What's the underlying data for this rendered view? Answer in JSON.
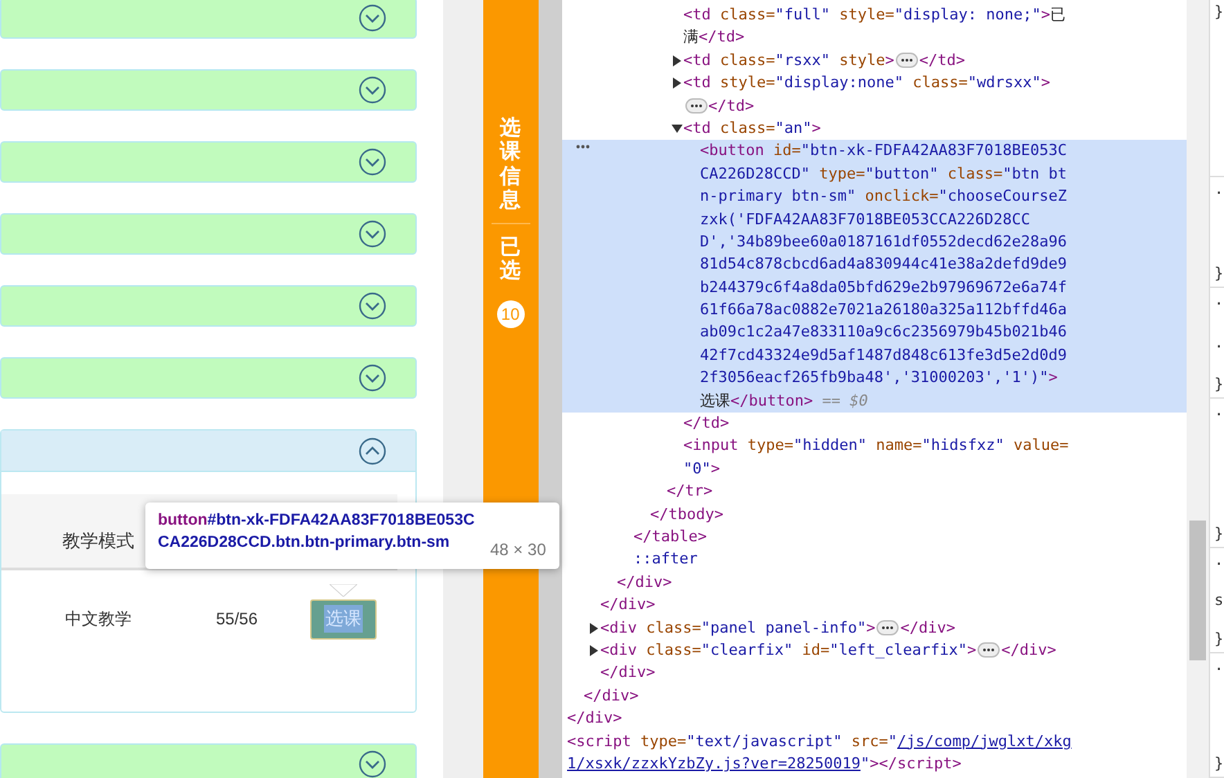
{
  "panels": [
    {
      "expanded": false
    },
    {
      "expanded": false
    },
    {
      "expanded": false
    },
    {
      "expanded": false
    },
    {
      "expanded": false
    },
    {
      "expanded": false
    },
    {
      "expanded": true,
      "table": {
        "columns": [
          "教学模式"
        ],
        "rows": [
          {
            "cells": [
              "中文教学",
              "55/56"
            ],
            "button": "选课"
          }
        ]
      }
    },
    {
      "expanded": false
    }
  ],
  "inspect_tooltip": {
    "tag": "button",
    "selector": "#btn-xk-FDFA42AA83F7018BE053CCA226D28CCD.btn.btn-primary.btn-sm",
    "size": "48 × 30"
  },
  "side_tab": {
    "label": "选课信息",
    "selected_label": "已选",
    "count": "10"
  },
  "elements": [
    {
      "children": [
        {
          "children": [
            {
              "children": [
                {
                  "children": [
                    {
                      "children": [
                        {
                          "children": [
                            {
                              "children": [
                                {
                                  "selected": false,
                                  "lines": [
                                    [
                                      {
                                        "kind": "tag",
                                        "text": "<td"
                                      },
                                      {
                                        "kind": "attr",
                                        "text": " class="
                                      },
                                      {
                                        "kind": "val",
                                        "text": "\"full\""
                                      },
                                      {
                                        "kind": "attr",
                                        "text": " style="
                                      },
                                      {
                                        "kind": "val",
                                        "text": "\"display: none;\""
                                      },
                                      {
                                        "kind": "tag",
                                        "text": ">"
                                      },
                                      {
                                        "kind": "text",
                                        "text": "已"
                                      }
                                    ],
                                    [
                                      {
                                        "kind": "text",
                                        "text": "满"
                                      },
                                      {
                                        "kind": "tag",
                                        "text": "</td>"
                                      }
                                    ]
                                  ]
                                },
                                {
                                  "selected": false,
                                  "expanded": false,
                                  "lines": [
                                    [
                                      {
                                        "kind": "tag",
                                        "text": "<td"
                                      },
                                      {
                                        "kind": "attr",
                                        "text": " class="
                                      },
                                      {
                                        "kind": "val",
                                        "text": "\"rsxx\""
                                      },
                                      {
                                        "kind": "attr",
                                        "text": " style"
                                      },
                                      {
                                        "kind": "tag",
                                        "text": ">"
                                      },
                                      {
                                        "kind": "badge"
                                      },
                                      {
                                        "kind": "tag",
                                        "text": "</td>"
                                      }
                                    ]
                                  ]
                                },
                                {
                                  "selected": false,
                                  "expanded": false,
                                  "lines": [
                                    [
                                      {
                                        "kind": "tag",
                                        "text": "<td"
                                      },
                                      {
                                        "kind": "attr",
                                        "text": " style="
                                      },
                                      {
                                        "kind": "val",
                                        "text": "\"display:none\""
                                      },
                                      {
                                        "kind": "attr",
                                        "text": " class="
                                      },
                                      {
                                        "kind": "val",
                                        "text": "\"wdrsxx\""
                                      },
                                      {
                                        "kind": "tag",
                                        "text": ">"
                                      }
                                    ],
                                    [
                                      {
                                        "kind": "badge"
                                      },
                                      {
                                        "kind": "tag",
                                        "text": "</td>"
                                      }
                                    ]
                                  ]
                                },
                                {
                                  "selected": false,
                                  "expanded": true,
                                  "lines": [
                                    [
                                      {
                                        "kind": "tag",
                                        "text": "<td"
                                      },
                                      {
                                        "kind": "attr",
                                        "text": " class="
                                      },
                                      {
                                        "kind": "val",
                                        "text": "\"an\""
                                      },
                                      {
                                        "kind": "tag",
                                        "text": ">"
                                      }
                                    ]
                                  ],
                                  "children": [
                                    {
                                      "selected": true,
                                      "lines": [
                                        [
                                          {
                                            "kind": "tag",
                                            "text": "<button"
                                          },
                                          {
                                            "kind": "attr",
                                            "text": " id="
                                          },
                                          {
                                            "kind": "val",
                                            "text": "\"btn-xk-FDFA42AA83F7018BE053C"
                                          }
                                        ],
                                        [
                                          {
                                            "kind": "val",
                                            "text": "CA226D28CCD\""
                                          },
                                          {
                                            "kind": "attr",
                                            "text": " type="
                                          },
                                          {
                                            "kind": "val",
                                            "text": "\"button\""
                                          },
                                          {
                                            "kind": "attr",
                                            "text": " class="
                                          },
                                          {
                                            "kind": "val",
                                            "text": "\"btn bt"
                                          }
                                        ],
                                        [
                                          {
                                            "kind": "val",
                                            "text": "n-primary btn-sm\""
                                          },
                                          {
                                            "kind": "attr",
                                            "text": " onclick="
                                          },
                                          {
                                            "kind": "val",
                                            "text": "\"chooseCourseZ"
                                          }
                                        ],
                                        [
                                          {
                                            "kind": "val",
                                            "text": "zxk('FDFA42AA83F7018BE053CCA226D28CC"
                                          }
                                        ],
                                        [
                                          {
                                            "kind": "val",
                                            "text": "D','34b89bee60a0187161df0552decd62e28a96"
                                          }
                                        ],
                                        [
                                          {
                                            "kind": "val",
                                            "text": "81d54c878cbcd6ad4a830944c41e38a2defd9de9"
                                          }
                                        ],
                                        [
                                          {
                                            "kind": "val",
                                            "text": "b244379c6f4a8da05bfd629e2b97969672e6a74f"
                                          }
                                        ],
                                        [
                                          {
                                            "kind": "val",
                                            "text": "61f66a78ac0882e7021a26180a325a112bffd46a"
                                          }
                                        ],
                                        [
                                          {
                                            "kind": "val",
                                            "text": "ab09c1c2a47e833110a9c6c2356979b45b021b46"
                                          }
                                        ],
                                        [
                                          {
                                            "kind": "val",
                                            "text": "42f7cd43324e9d5af1487d848c613fe3d5e2d0d9"
                                          }
                                        ],
                                        [
                                          {
                                            "kind": "val",
                                            "text": "2f3056eacf265fb9ba48','31000203','1')\""
                                          },
                                          {
                                            "kind": "tag",
                                            "text": ">"
                                          }
                                        ],
                                        [
                                          {
                                            "kind": "text",
                                            "text": "选课"
                                          },
                                          {
                                            "kind": "tag",
                                            "text": "</button>"
                                          },
                                          {
                                            "kind": "dim",
                                            "text": " == $0"
                                          }
                                        ]
                                      ]
                                    }
                                  ]
                                },
                                {
                                  "selected": false,
                                  "lines": [
                                    [
                                      {
                                        "kind": "tag",
                                        "text": "</td>"
                                      }
                                    ]
                                  ]
                                },
                                {
                                  "selected": false,
                                  "lines": [
                                    [
                                      {
                                        "kind": "tag",
                                        "text": "<input"
                                      },
                                      {
                                        "kind": "attr",
                                        "text": " type="
                                      },
                                      {
                                        "kind": "val",
                                        "text": "\"hidden\""
                                      },
                                      {
                                        "kind": "attr",
                                        "text": " name="
                                      },
                                      {
                                        "kind": "val",
                                        "text": "\"hidsfxz\""
                                      },
                                      {
                                        "kind": "attr",
                                        "text": " value="
                                      }
                                    ],
                                    [
                                      {
                                        "kind": "val",
                                        "text": "\"0\""
                                      },
                                      {
                                        "kind": "tag",
                                        "text": ">"
                                      }
                                    ]
                                  ]
                                }
                              ]
                            },
                            {
                              "selected": false,
                              "lines": [
                                [
                                  {
                                    "kind": "tag",
                                    "text": "</tr>"
                                  }
                                ]
                              ]
                            }
                          ]
                        },
                        {
                          "selected": false,
                          "lines": [
                            [
                              {
                                "kind": "tag",
                                "text": "</tbody>"
                              }
                            ]
                          ]
                        }
                      ]
                    },
                    {
                      "selected": false,
                      "lines": [
                        [
                          {
                            "kind": "tag",
                            "text": "</table>"
                          }
                        ]
                      ]
                    },
                    {
                      "selected": false,
                      "lines": [
                        [
                          {
                            "kind": "pseudo",
                            "text": "::after"
                          }
                        ]
                      ]
                    }
                  ]
                },
                {
                  "selected": false,
                  "lines": [
                    [
                      {
                        "kind": "tag",
                        "text": "</div>"
                      }
                    ]
                  ]
                }
              ]
            },
            {
              "selected": false,
              "lines": [
                [
                  {
                    "kind": "tag",
                    "text": "</div>"
                  }
                ]
              ]
            },
            {
              "selected": false,
              "expanded": false,
              "lines": [
                [
                  {
                    "kind": "tag",
                    "text": "<div"
                  },
                  {
                    "kind": "attr",
                    "text": " class="
                  },
                  {
                    "kind": "val",
                    "text": "\"panel panel-info\""
                  },
                  {
                    "kind": "tag",
                    "text": ">"
                  },
                  {
                    "kind": "badge"
                  },
                  {
                    "kind": "tag",
                    "text": "</div>"
                  }
                ]
              ]
            },
            {
              "selected": false,
              "expanded": false,
              "lines": [
                [
                  {
                    "kind": "tag",
                    "text": "<div"
                  },
                  {
                    "kind": "attr",
                    "text": " class="
                  },
                  {
                    "kind": "val",
                    "text": "\"clearfix\""
                  },
                  {
                    "kind": "attr",
                    "text": " id="
                  },
                  {
                    "kind": "val",
                    "text": "\"left_clearfix\""
                  },
                  {
                    "kind": "tag",
                    "text": ">"
                  },
                  {
                    "kind": "badge"
                  },
                  {
                    "kind": "tag",
                    "text": "</div>"
                  }
                ]
              ]
            },
            {
              "selected": false,
              "lines": [
                [
                  {
                    "kind": "tag",
                    "text": "</div>"
                  }
                ]
              ]
            }
          ]
        },
        {
          "selected": false,
          "lines": [
            [
              {
                "kind": "tag",
                "text": "</div>"
              }
            ]
          ]
        }
      ]
    },
    {
      "selected": false,
      "lines": [
        [
          {
            "kind": "tag",
            "text": "</div>"
          }
        ]
      ]
    },
    {
      "selected": false,
      "lines": [
        [
          {
            "kind": "tag",
            "text": "<script"
          },
          {
            "kind": "attr",
            "text": " type="
          },
          {
            "kind": "val",
            "text": "\"text/javascript\""
          },
          {
            "kind": "attr",
            "text": " src="
          },
          {
            "kind": "val",
            "text": "\""
          },
          {
            "kind": "link",
            "text": "/js/comp/jwglxt/xkg"
          }
        ],
        [
          {
            "kind": "link",
            "text": "1/xsxk/zzxkYzbZy.js?ver=28250019"
          },
          {
            "kind": "val",
            "text": "\""
          },
          {
            "kind": "tag",
            "text": "></script>"
          }
        ]
      ]
    }
  ],
  "styles_pane": [
    [
      "}"
    ],
    [
      ".",
      "}"
    ],
    [
      ".",
      ".",
      "}"
    ],
    [
      ".",
      "}"
    ],
    [
      ".",
      "s",
      "}"
    ],
    [
      ".",
      "}"
    ]
  ]
}
